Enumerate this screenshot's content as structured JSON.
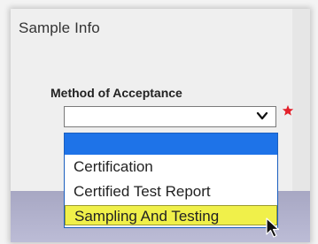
{
  "panel": {
    "title": "Sample Info"
  },
  "field": {
    "label": "Method of Acceptance",
    "selected_value": "",
    "required": true
  },
  "dropdown": {
    "options": [
      {
        "label": ""
      },
      {
        "label": "Certification"
      },
      {
        "label": "Certified Test Report"
      },
      {
        "label": "Sampling And Testing"
      }
    ],
    "keyboard_focus_index": 0,
    "hover_index": 3
  },
  "colors": {
    "focus_blue": "#1e73e8",
    "hover_yellow": "#f0f04a",
    "required_red": "#e3202a"
  },
  "icons": {
    "select_arrow": "chevron-down-icon",
    "required": "star-icon",
    "pointer": "mouse-cursor-icon"
  }
}
